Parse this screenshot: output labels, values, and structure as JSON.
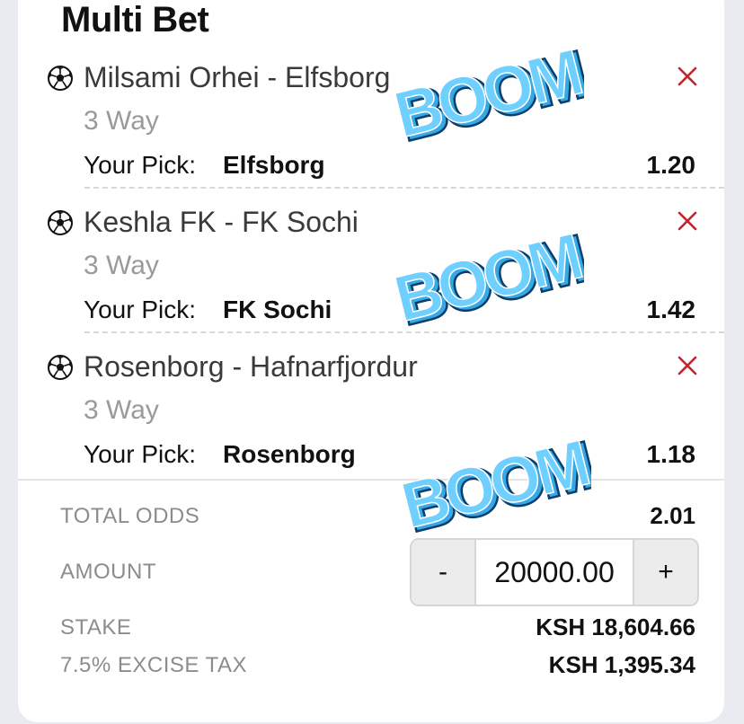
{
  "title": "Multi Bet",
  "bets": [
    {
      "match": "Milsami Orhei - Elfsborg",
      "market": "3 Way",
      "pick_label": "Your Pick:",
      "pick": "Elfsborg",
      "odds": "1.20"
    },
    {
      "match": "Keshla FK - FK Sochi",
      "market": "3 Way",
      "pick_label": "Your Pick:",
      "pick": "FK Sochi",
      "odds": "1.42"
    },
    {
      "match": "Rosenborg - Hafnarfjordur",
      "market": "3 Way",
      "pick_label": "Your Pick:",
      "pick": "Rosenborg",
      "odds": "1.18"
    }
  ],
  "summary": {
    "total_odds_label": "TOTAL ODDS",
    "total_odds": "2.01",
    "amount_label": "AMOUNT",
    "amount": "20000.00",
    "minus": "-",
    "plus": "+",
    "stake_label": "STAKE",
    "stake": "KSH 18,604.66",
    "tax_label": "7.5% EXCISE TAX",
    "tax": "KSH 1,395.34"
  },
  "sticker_text": "BOOM",
  "colors": {
    "remove": "#c0262d",
    "boom_fill": "#35a9e6",
    "boom_outline": "#0b3d6b"
  },
  "icons": {
    "sport": "soccer-ball-icon",
    "remove": "close-icon"
  }
}
